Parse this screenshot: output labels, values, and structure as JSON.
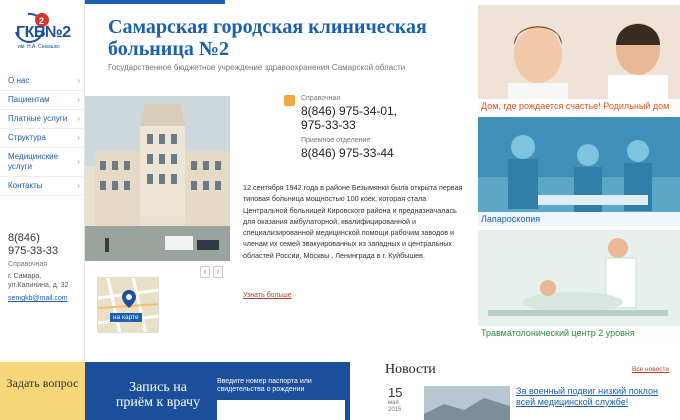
{
  "logo": {
    "text": "ГКБ№2",
    "sub": "им. Н.А. Семашко"
  },
  "nav": [
    {
      "label": "О нас"
    },
    {
      "label": "Пациентам"
    },
    {
      "label": "Платные услуги"
    },
    {
      "label": "Структура"
    },
    {
      "label": "Медицинские услуги"
    },
    {
      "label": "Контакты"
    }
  ],
  "sidebar": {
    "phone_code": "8(846)",
    "phone": "975-33-33",
    "phone_label": "Справочная",
    "address_line1": "г. Самара,",
    "address_line2": "ул.Калинина, д. 32",
    "email": "semgkb@mail.com"
  },
  "header": {
    "title": "Самарская городская клиническая больница №2",
    "subtitle": "Государственное бюджетное учреждение здравоохранения Самарской области"
  },
  "contacts": {
    "ref_label": "Справочная",
    "ref_phone_1": "8(846) 975-34-01,",
    "ref_phone_2": "975-33-33",
    "admission_label": "Приемное отделение",
    "admission_phone": "8(846) 975-33-44"
  },
  "history": {
    "text": "12 сентября 1942 года в районе Безымянки была открыта первая типовая больница мощностью 100 коек, которая стала Центральной больницей Кировского района и предназначалась для оказания амбулаторной, квалифицированной и специализированной медицинской помощи рабочим заводов и членам их семей эвакуированных из западных и центральных областей России, Москвы , Ленинграда в г. Куйбышев.",
    "more": "Узнать больше"
  },
  "slider": {
    "prev": "‹",
    "next": "›"
  },
  "map": {
    "label": "на карте"
  },
  "promos": [
    {
      "caption": "Дом, где рождается счастье! Родильный дом",
      "color": "#e8521a"
    },
    {
      "caption": "Лапароскопия",
      "color": "#1b5fae"
    },
    {
      "caption": "Травматолонический центр 2 уровня",
      "color": "#2e8b3a"
    }
  ],
  "bottom": {
    "question": "Задать вопрос",
    "appointment": "Запись на приём к врачу",
    "appointment_hint": "Введите номер паспорта или свидетельства о рождении"
  },
  "news": {
    "title": "Новости",
    "all": "Все новости",
    "items": [
      {
        "day": "15",
        "month": "мая",
        "year": "2015",
        "headline": "За военный подвиг низкий поклон всей медицинской службе!"
      }
    ]
  },
  "colors": {
    "brand": "#1b5fae",
    "accent": "#e8521a",
    "question_bg": "#f5d679"
  },
  "icons": [
    "phone-icon",
    "map-pin-icon",
    "chevron-right-icon"
  ]
}
